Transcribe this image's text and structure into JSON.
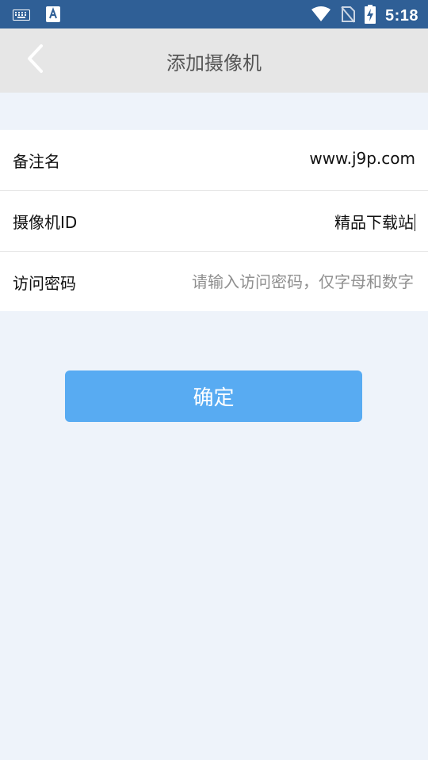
{
  "status_bar": {
    "time": "5:18",
    "icons": [
      "keyboard-icon",
      "app-a-icon",
      "wifi-icon",
      "no-sim-icon",
      "battery-charging-icon"
    ]
  },
  "appbar": {
    "title": "添加摄像机",
    "back_icon": "chevron-left-icon"
  },
  "form": {
    "alias": {
      "label": "备注名",
      "value": "www.j9p.com"
    },
    "camera_id": {
      "label": "摄像机ID",
      "value": "精品下载站"
    },
    "password": {
      "label": "访问密码",
      "placeholder": "请输入访问密码，仅字母和数字"
    }
  },
  "confirm_button": {
    "label": "确定"
  },
  "colors": {
    "status_bar": "#2f5f96",
    "appbar": "#e6e6e6",
    "background": "#eef3fa",
    "button": "#58abf2"
  }
}
